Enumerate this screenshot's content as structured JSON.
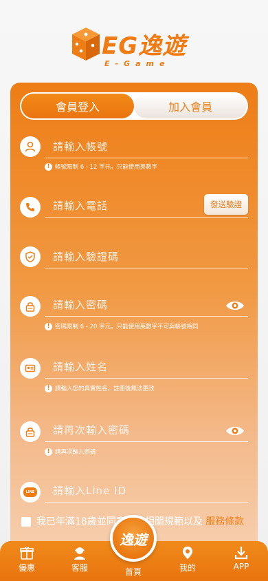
{
  "brand": {
    "logo_main": "EG逸遊",
    "logo_sub": "E-Game",
    "center_logo": "逸遊"
  },
  "tabs": {
    "login": "會員登入",
    "register": "加入會員"
  },
  "fields": {
    "account": {
      "placeholder": "請輸入帳號",
      "hint": "帳號限制 6 - 12 字元，只能使用英數字"
    },
    "phone": {
      "placeholder": "請輸入電話",
      "button": "發送驗證"
    },
    "code": {
      "placeholder": "請輸入驗證碼"
    },
    "password": {
      "placeholder": "請輸入密碼",
      "hint": "密碼限制 6 - 20 字元，只能使用英數字不可與帳號相同"
    },
    "name": {
      "placeholder": "請輸入姓名",
      "hint": "請輸入您的真實姓名，註冊後無法更改"
    },
    "confirm": {
      "placeholder": "請再次輸入密碼",
      "hint": "請再次輸入密碼"
    },
    "line": {
      "placeholder": "請輸入Line ID",
      "icon_text": "LINE"
    }
  },
  "agreement": {
    "text": "我已年滿18歲並同意遵守相關規範以及",
    "link": "服務條款"
  },
  "nav": {
    "promo": "優惠",
    "service": "客服",
    "home": "首頁",
    "mine": "我的",
    "app": "APP"
  },
  "colors": {
    "accent": "#ee7d15",
    "white": "#ffffff"
  }
}
